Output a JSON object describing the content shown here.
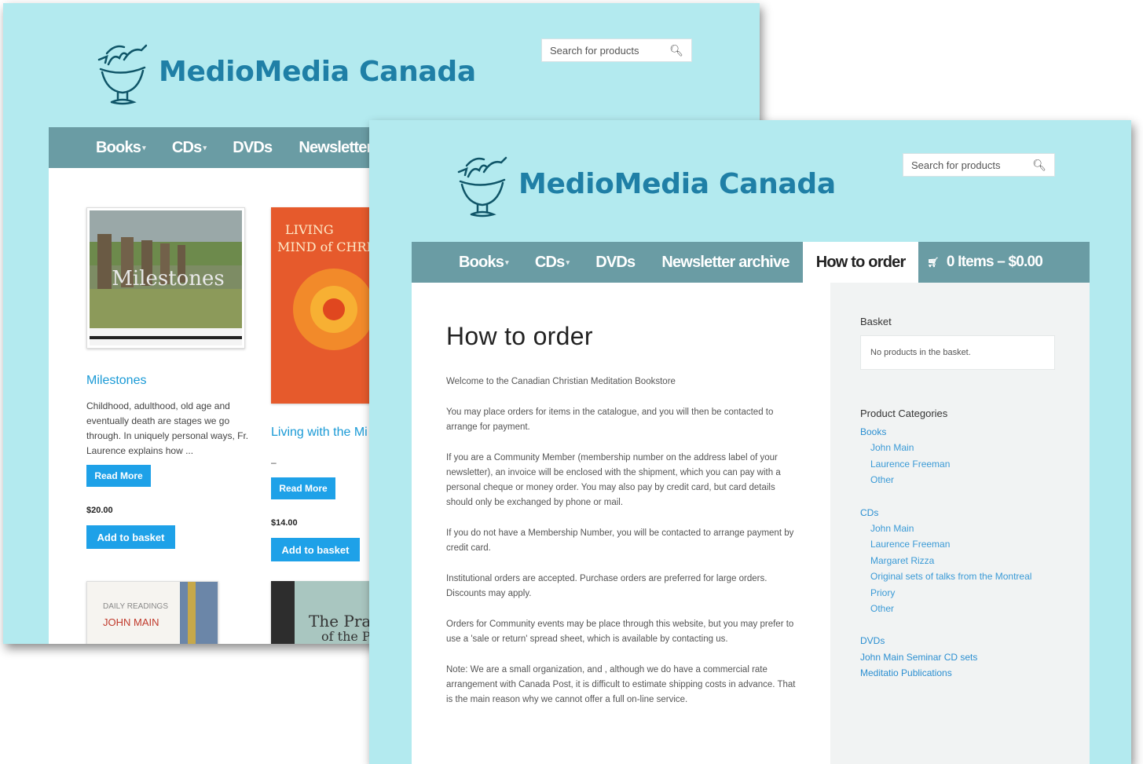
{
  "brand": {
    "name": "MedioMedia Canada"
  },
  "colors": {
    "background": "#b3eaef",
    "navbar": "#6a9ca4",
    "accent": "#1ea1e8",
    "link": "#2b8fd1",
    "brand": "#1f7fa6"
  },
  "search": {
    "placeholder": "Search for products",
    "icon": "search-icon"
  },
  "nav": {
    "books": "Books",
    "cds": "CDs",
    "dvds": "DVDs",
    "newsletter": "Newsletter archive",
    "how_to_order": "How to order"
  },
  "cart": {
    "icon": "cart-icon",
    "summary": "0 Items – $0.00"
  },
  "products": [
    {
      "title": "Milestones",
      "cover_text": "Milestones",
      "description": "Childhood, adulthood, old age and eventually death are stages we go through. In uniquely personal ways, Fr. Laurence explains how ...",
      "read_more": "Read More",
      "price": "$20.00",
      "add_to_basket": "Add to basket"
    },
    {
      "title": "Living with the Mi",
      "cover_line1": "LIVING",
      "cover_line2": "MIND of CHRI",
      "description": "–",
      "read_more": "Read More",
      "price": "$14.00",
      "add_to_basket": "Add to basket"
    },
    {
      "cover_line1": "DAILY READINGS",
      "cover_line2": "JOHN MAIN"
    },
    {
      "cover_line1": "The Pra",
      "cover_line2": "of the Pri"
    }
  ],
  "page": {
    "title": "How to order",
    "paragraphs": [
      "Welcome to the Canadian Christian Meditation Bookstore",
      "You may place orders for items in the catalogue, and you will then be contacted to arrange for payment.",
      "If you are a Community Member (membership number on the address label of your newsletter), an invoice will be enclosed with the shipment, which you can pay with a personal cheque or money order. You may also pay by credit card, but card details should only be exchanged by phone or mail.",
      "If you do not have a Membership Number, you will be contacted to arrange payment by credit card.",
      "Institutional orders are accepted. Purchase orders are preferred for large orders. Discounts may apply.",
      "Orders for Community events may be place through this website, but you may prefer to use a 'sale or return' spread sheet, which is available by contacting us.",
      "Note: We are a small organization, and , although we do have a commercial rate arrangement with Canada Post, it is difficult to estimate shipping costs in advance. That is the main reason why we cannot offer a full on-line service."
    ]
  },
  "sidebar": {
    "basket_heading": "Basket",
    "basket_empty": "No products in the basket.",
    "categories_heading": "Product Categories",
    "categories": {
      "books": "Books",
      "books_children": [
        "John Main",
        "Laurence Freeman",
        "Other"
      ],
      "cds": "CDs",
      "cds_children": [
        "John Main",
        "Laurence Freeman",
        "Margaret Rizza",
        "Original sets of talks from the Montreal",
        "Priory",
        "Other"
      ],
      "dvds": "DVDs",
      "extra": [
        "John Main Seminar CD sets",
        "Meditatio Publications"
      ]
    }
  }
}
